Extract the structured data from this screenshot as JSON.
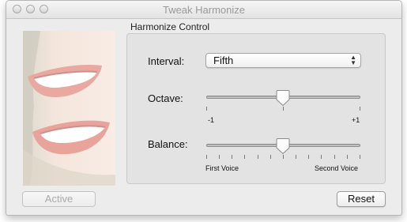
{
  "window": {
    "title": "Tweak Harmonize",
    "buttons": [
      "close-icon",
      "minimize-icon",
      "zoom-icon"
    ]
  },
  "group": {
    "title": "Harmonize Control"
  },
  "interval": {
    "label": "Interval:",
    "selected": "Fifth"
  },
  "octave": {
    "label": "Octave:",
    "min_label": "-1",
    "max_label": "+1",
    "value": 0
  },
  "balance": {
    "label": "Balance:",
    "min_label": "First Voice",
    "max_label": "Second Voice",
    "value_fraction": 0.5
  },
  "buttons": {
    "active_label": "Active",
    "reset_label": "Reset"
  },
  "colors": {
    "window_bg": "#ececec",
    "group_bg": "#e3e3e3",
    "disabled_text": "#a9a9a9"
  }
}
